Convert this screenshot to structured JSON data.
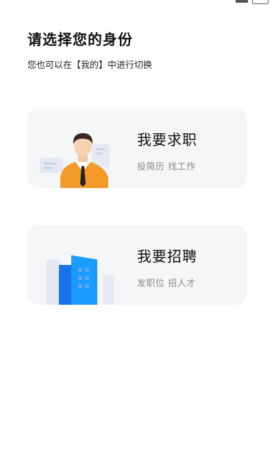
{
  "header": {
    "title": "请选择您的身份",
    "subtitle": "您也可以在【我的】中进行切换"
  },
  "cards": [
    {
      "title": "我要求职",
      "desc": "投简历 找工作",
      "icon": "job-seeker-illustration"
    },
    {
      "title": "我要招聘",
      "desc": "发职位 招人才",
      "icon": "recruiter-building-illustration"
    }
  ],
  "colors": {
    "card_bg": "#f5f6f8",
    "shirt_orange": "#f39a2b",
    "building_blue": "#1a8cff",
    "desc_gray": "#888888"
  }
}
